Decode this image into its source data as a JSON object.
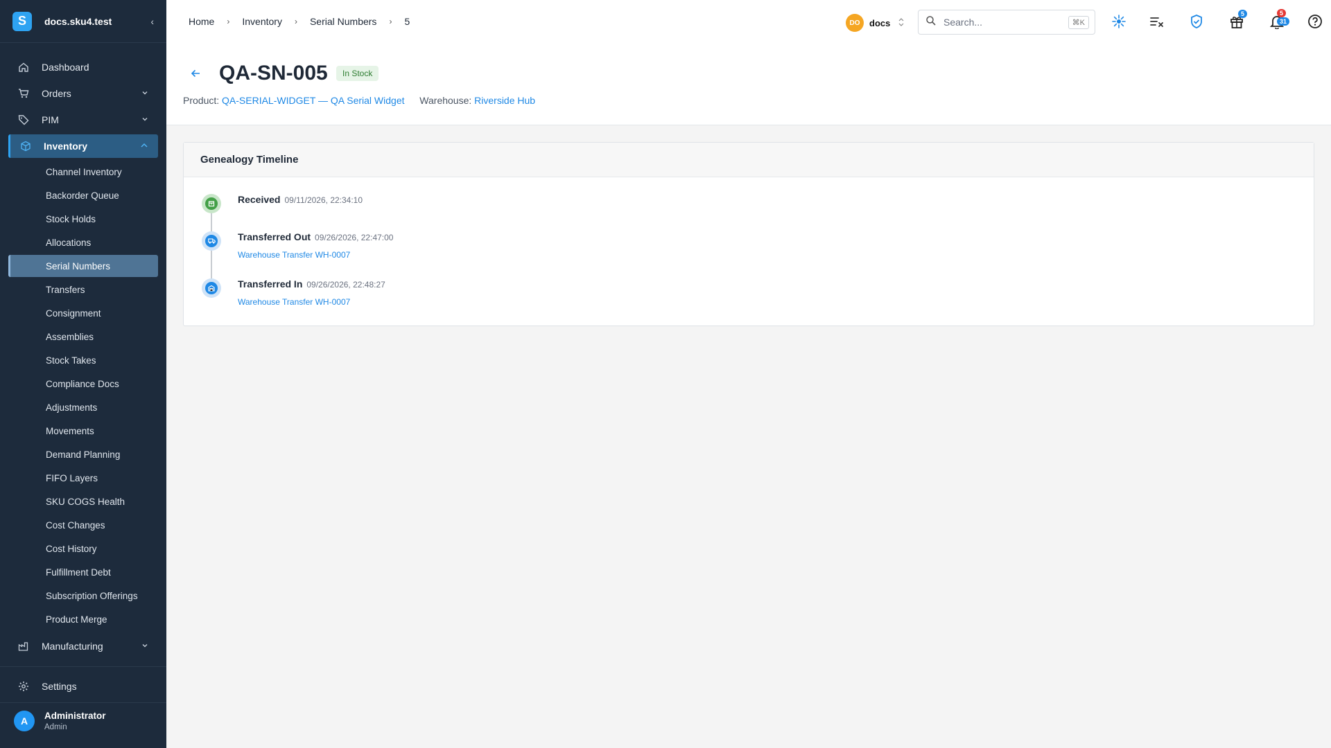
{
  "app": {
    "logo_letter": "S",
    "site_name": "docs.sku4.test",
    "accent": "#2ea3f2"
  },
  "sidebar": {
    "main_items": [
      {
        "label": "Dashboard",
        "icon": "home-icon"
      },
      {
        "label": "Orders",
        "icon": "cart-icon"
      },
      {
        "label": "PIM",
        "icon": "tag-icon"
      },
      {
        "label": "Inventory",
        "icon": "cube-icon",
        "active": true
      }
    ],
    "inventory_sub": [
      "Channel Inventory",
      "Backorder Queue",
      "Stock Holds",
      "Allocations",
      "Serial Numbers",
      "Transfers",
      "Consignment",
      "Assemblies",
      "Stock Takes",
      "Compliance Docs",
      "Adjustments",
      "Movements",
      "Demand Planning",
      "FIFO Layers",
      "SKU COGS Health",
      "Cost Changes",
      "Cost History",
      "Fulfillment Debt",
      "Subscription Offerings",
      "Product Merge"
    ],
    "active_sub": "Serial Numbers",
    "manufacturing_label": "Manufacturing",
    "settings_label": "Settings",
    "user": {
      "initial": "A",
      "name": "Administrator",
      "role": "Admin"
    }
  },
  "topbar": {
    "breadcrumbs": [
      "Home",
      "Inventory",
      "Serial Numbers",
      "5"
    ],
    "tenant": {
      "initials": "DO",
      "name": "docs"
    },
    "search": {
      "placeholder": "Search...",
      "shortcut": "⌘K"
    },
    "gift_badge": "5",
    "notif_badge_top": "5",
    "notif_badge_bottom": "31"
  },
  "page": {
    "title": "QA-SN-005",
    "status": "In Stock",
    "product_label": "Product:",
    "product_value": "QA-SERIAL-WIDGET — QA Serial Widget",
    "warehouse_label": "Warehouse:",
    "warehouse_value": "Riverside Hub"
  },
  "timeline": {
    "title": "Genealogy Timeline",
    "events": [
      {
        "title": "Received",
        "time": "09/11/2026, 22:34:10",
        "link": "",
        "color": "green",
        "icon": "package-icon"
      },
      {
        "title": "Transferred Out",
        "time": "09/26/2026, 22:47:00",
        "link": "Warehouse Transfer WH-0007",
        "color": "blue",
        "icon": "truck-icon"
      },
      {
        "title": "Transferred In",
        "time": "09/26/2026, 22:48:27",
        "link": "Warehouse Transfer WH-0007",
        "color": "blue",
        "icon": "warehouse-icon"
      }
    ]
  }
}
